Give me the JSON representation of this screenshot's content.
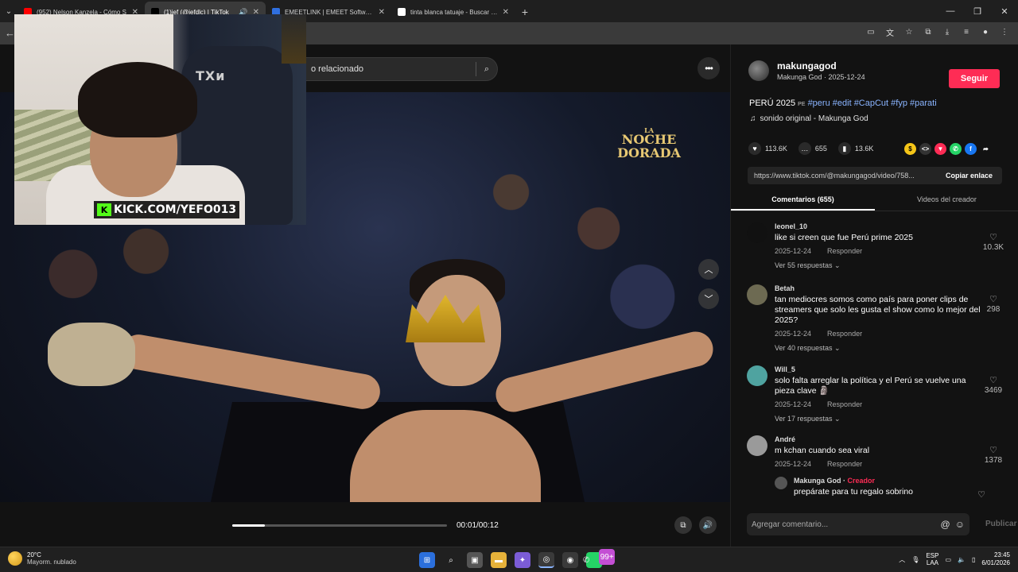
{
  "browser": {
    "tabs": [
      {
        "title": "(952) Nelson Kanzela - Cómo S",
        "color": "#ff0000",
        "active": false
      },
      {
        "title": "(1)jef (@jefdlc) | TikTok",
        "color": "#000000",
        "active": true
      },
      {
        "title": "EMEETLINK | EMEET Software S",
        "color": "#2f6fe0",
        "active": false
      },
      {
        "title": "tinta blanca tatuaje - Buscar co",
        "color": "#ffffff",
        "active": false
      }
    ],
    "newtab": "+"
  },
  "video": {
    "search_text": "o relacionado",
    "event_logo_small": "LA",
    "event_logo_big1": "NOCHE",
    "event_logo_big2": "DORADA",
    "timecode": "00:01/00:12",
    "progress_fraction": 0.15
  },
  "webcam": {
    "kick_label": "KICK.COM/YEFO013",
    "chair_text": "TXи"
  },
  "post": {
    "username": "makungagod",
    "subline": "Makunga God · 2025-12-24",
    "follow_label": "Seguir",
    "caption_text": "PERÚ 2025",
    "caption_flag": "PE",
    "hashtags": [
      "#peru",
      "#edit",
      "#CapCut",
      "#fyp",
      "#parati"
    ],
    "sound": "sonido original - Makunga God",
    "likes": "113.6K",
    "comments_count": "655",
    "saves": "13.6K",
    "url": "https://www.tiktok.com/@makungagod/video/758...",
    "copy_label": "Copiar enlace",
    "tab_comments": "Comentarios (655)",
    "tab_videos": "Videos del creador"
  },
  "comments": [
    {
      "user": "leonel_10",
      "text": "like si creen que fue Perú prime 2025",
      "date": "2025-12-24",
      "reply_label": "Responder",
      "likes": "10.3K",
      "replies": "Ver 55 respuestas ⌄"
    },
    {
      "user": "Betah",
      "text": "tan mediocres somos como país para poner clips de streamers que solo les gusta el show como lo mejor del 2025?",
      "date": "2025-12-24",
      "reply_label": "Responder",
      "likes": "298",
      "replies": "Ver 40 respuestas ⌄"
    },
    {
      "user": "Will_5",
      "text": "solo falta arreglar la política y el Perú se vuelve una pieza clave 🗿",
      "date": "2025-12-24",
      "reply_label": "Responder",
      "likes": "3469",
      "replies": "Ver 17 respuestas ⌄"
    },
    {
      "user": "André",
      "text": "m kchan cuando sea viral",
      "date": "2025-12-24",
      "reply_label": "Responder",
      "likes": "1378",
      "replies": ""
    }
  ],
  "creator_reply": {
    "user": "Makunga God",
    "sep": " · ",
    "badge": "Creador",
    "text": "prepárate para tu regalo sobrino"
  },
  "comment_input": {
    "placeholder": "Agregar comentario...",
    "publish": "Publicar"
  },
  "taskbar": {
    "temp": "20°C",
    "weather": "Mayorm. nublado",
    "badge": "99+",
    "lang1": "ESP",
    "lang2": "LAA",
    "time": "23:45",
    "date": "6/01/2026"
  }
}
